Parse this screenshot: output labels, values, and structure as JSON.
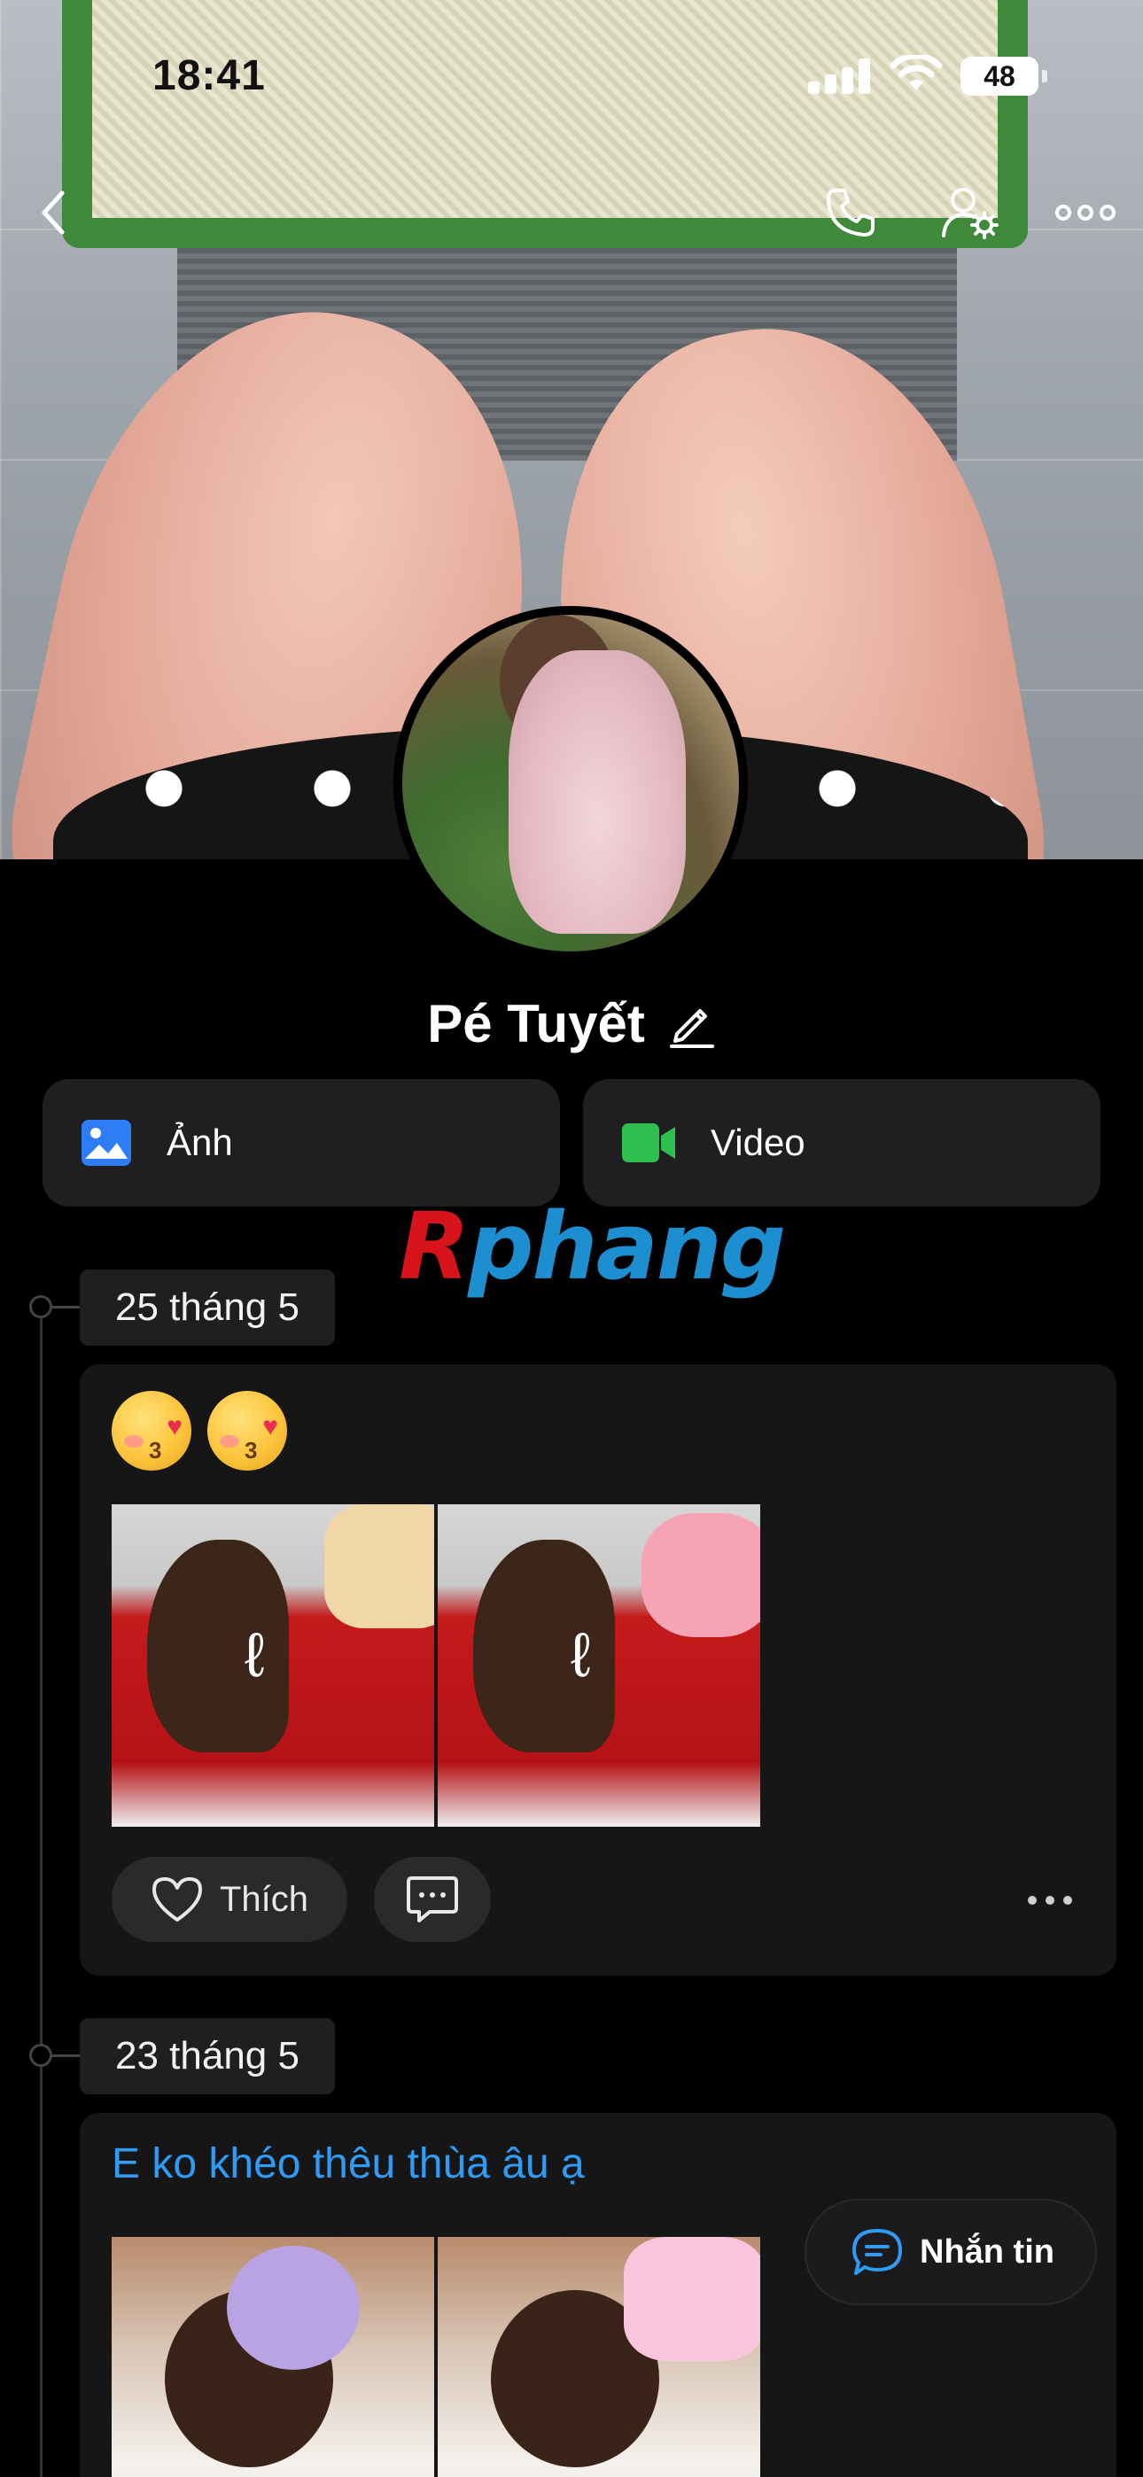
{
  "status_bar": {
    "time": "18:41",
    "battery": "48"
  },
  "profile": {
    "name": "Pé Tuyết"
  },
  "media_buttons": {
    "photos_label": "Ảnh",
    "videos_label": "Video"
  },
  "watermark": {
    "part1": "R",
    "part2": "phang"
  },
  "posts": [
    {
      "date": "25 tháng 5",
      "emojis": [
        "😘",
        "😘"
      ],
      "like_label": "Thích"
    },
    {
      "date": "23 tháng 5",
      "caption": "E ko khéo thêu thùa âu ạ"
    }
  ],
  "floating": {
    "message_label": "Nhắn tin"
  },
  "colors": {
    "background": "#000000",
    "card": "#161616",
    "chip": "#1f1f21",
    "caption_blue": "#2f9bf5",
    "photos_icon": "#2f7df6",
    "video_icon": "#2fbf4e"
  }
}
